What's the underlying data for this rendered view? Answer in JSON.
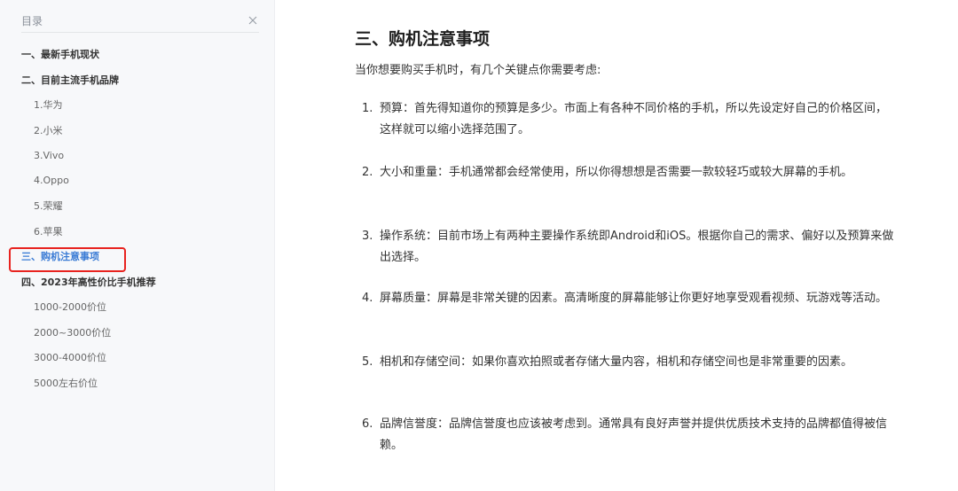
{
  "toc": {
    "title": "目录",
    "items": [
      {
        "label": "一、最新手机现状",
        "level": 1
      },
      {
        "label": "二、目前主流手机品牌",
        "level": 1
      },
      {
        "label": "1.华为",
        "level": 2
      },
      {
        "label": "2.小米",
        "level": 2
      },
      {
        "label": "3.Vivo",
        "level": 2
      },
      {
        "label": "4.Oppo",
        "level": 2
      },
      {
        "label": "5.荣耀",
        "level": 2
      },
      {
        "label": "6.苹果",
        "level": 2
      },
      {
        "label": "三、购机注意事项",
        "level": 1,
        "active": true
      },
      {
        "label": "四、2023年高性价比手机推荐",
        "level": 1
      },
      {
        "label": "1000-2000价位",
        "level": 2
      },
      {
        "label": "2000~3000价位",
        "level": 2
      },
      {
        "label": "3000-4000价位",
        "level": 2
      },
      {
        "label": "5000左右价位",
        "level": 2
      }
    ]
  },
  "content": {
    "title": "三、购机注意事项",
    "intro": "当你想要购买手机时，有几个关键点你需要考虑:",
    "points": [
      {
        "num": "1.",
        "text": "预算：首先得知道你的预算是多少。市面上有各种不同价格的手机，所以先设定好自己的价格区间，这样就可以缩小选择范围了。"
      },
      {
        "num": "2.",
        "text": "大小和重量：手机通常都会经常使用，所以你得想想是否需要一款较轻巧或较大屏幕的手机。"
      },
      {
        "num": "3.",
        "text": "操作系统：目前市场上有两种主要操作系统即Android和iOS。根据你自己的需求、偏好以及预算来做出选择。"
      },
      {
        "num": "4.",
        "text": "屏幕质量：屏幕是非常关键的因素。高清晰度的屏幕能够让你更好地享受观看视频、玩游戏等活动。"
      },
      {
        "num": "5.",
        "text": "相机和存储空间：如果你喜欢拍照或者存储大量内容，相机和存储空间也是非常重要的因素。"
      },
      {
        "num": "6.",
        "text": "品牌信誉度：品牌信誉度也应该被考虑到。通常具有良好声誉并提供优质技术支持的品牌都值得被信赖。"
      }
    ]
  },
  "colors": {
    "sidebar_bg": "#f7f8fa",
    "active_link": "#3a7bd5",
    "highlight_box": "#e8231f"
  }
}
